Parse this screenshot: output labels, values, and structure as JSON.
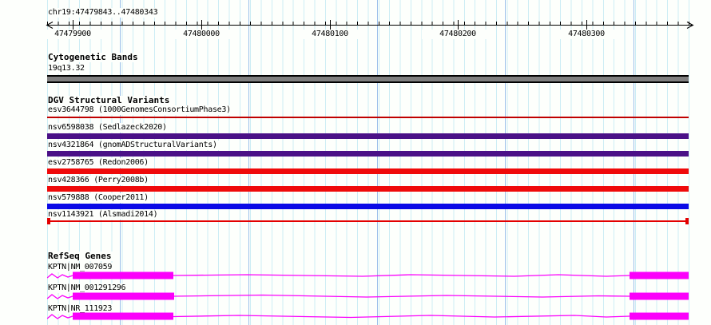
{
  "window": {
    "title": "chr19:47479843..47480343"
  },
  "ruler": {
    "tick_labels": [
      "47479900",
      "47480000",
      "47480100",
      "47480200",
      "47480300"
    ]
  },
  "cytogenetic_bands": {
    "heading": "Cytogenetic Bands",
    "band": "19q13.32",
    "band_color": "#7f7f7f"
  },
  "dgv_structural_variants": {
    "heading": "DGV Structural Variants",
    "variants": [
      {
        "label": "esv3644798 (1000GenomesConsortiumPhase3)",
        "color": "#c00000",
        "glyph": "thin-line"
      },
      {
        "label": "nsv6598038 (Sedlazeck2020)",
        "color": "#4a1187",
        "glyph": "bar"
      },
      {
        "label": "nsv4321864 (gnomADStructuralVariants)",
        "color": "#4a1187",
        "glyph": "bar"
      },
      {
        "label": "esv2758765 (Redon2006)",
        "color": "#ef0a0a",
        "glyph": "bar"
      },
      {
        "label": "nsv428366 (Perry2008b)",
        "color": "#ef0a0a",
        "glyph": "bar"
      },
      {
        "label": "nsv579888 (Cooper2011)",
        "color": "#0a0ae6",
        "glyph": "bar"
      },
      {
        "label": "nsv1143921 (Alsmadi2014)",
        "color": "#e30000",
        "glyph": "line-with-caps"
      }
    ]
  },
  "refseq_genes": {
    "heading": "RefSeq Genes",
    "color": "#fb00fb",
    "transcripts": [
      {
        "label": "KPTN|NM_007059"
      },
      {
        "label": "KPTN|NM_001291296"
      },
      {
        "label": "KPTN|NR_111923"
      }
    ]
  },
  "colors": {
    "grid_minor": "#cdedf5",
    "grid_major": "#9cc0ea",
    "background": "#fdfffc",
    "ruler": "#000000"
  }
}
